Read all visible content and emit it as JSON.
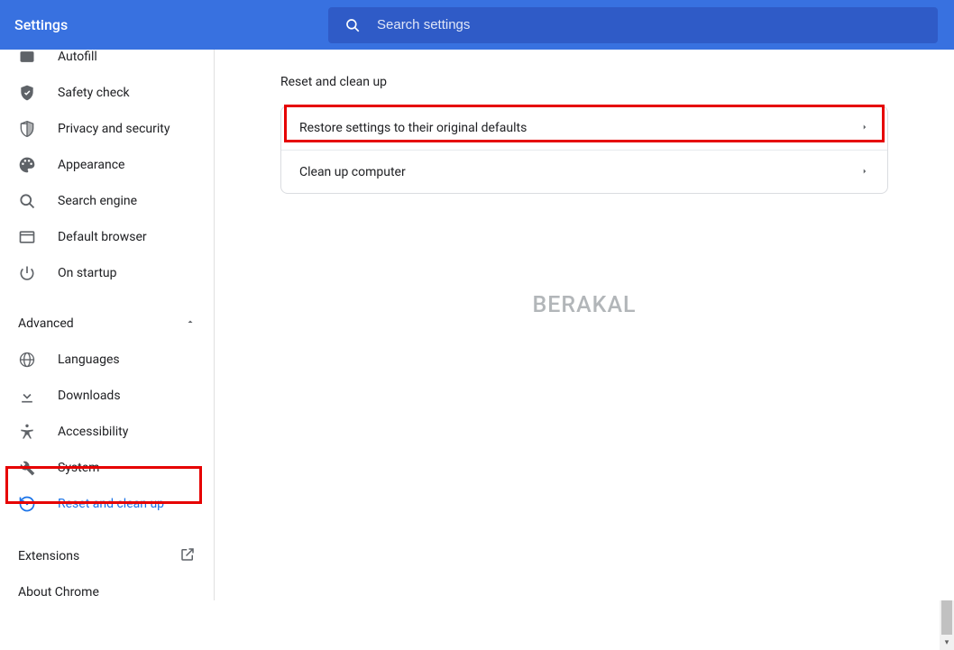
{
  "header": {
    "title": "Settings",
    "search_placeholder": "Search settings"
  },
  "sidebar": {
    "items": [
      {
        "label": "Autofill",
        "icon": "autofill"
      },
      {
        "label": "Safety check",
        "icon": "safety"
      },
      {
        "label": "Privacy and security",
        "icon": "privacy"
      },
      {
        "label": "Appearance",
        "icon": "appearance"
      },
      {
        "label": "Search engine",
        "icon": "search"
      },
      {
        "label": "Default browser",
        "icon": "browser"
      },
      {
        "label": "On startup",
        "icon": "startup"
      }
    ],
    "advanced_label": "Advanced",
    "advanced_items": [
      {
        "label": "Languages",
        "icon": "languages"
      },
      {
        "label": "Downloads",
        "icon": "downloads"
      },
      {
        "label": "Accessibility",
        "icon": "accessibility"
      },
      {
        "label": "System",
        "icon": "system"
      },
      {
        "label": "Reset and clean up",
        "icon": "reset",
        "active": true
      }
    ],
    "extensions_label": "Extensions",
    "about_label": "About Chrome"
  },
  "main": {
    "section_title": "Reset and clean up",
    "rows": [
      {
        "label": "Restore settings to their original defaults"
      },
      {
        "label": "Clean up computer"
      }
    ]
  },
  "watermark": "BERAKAL"
}
